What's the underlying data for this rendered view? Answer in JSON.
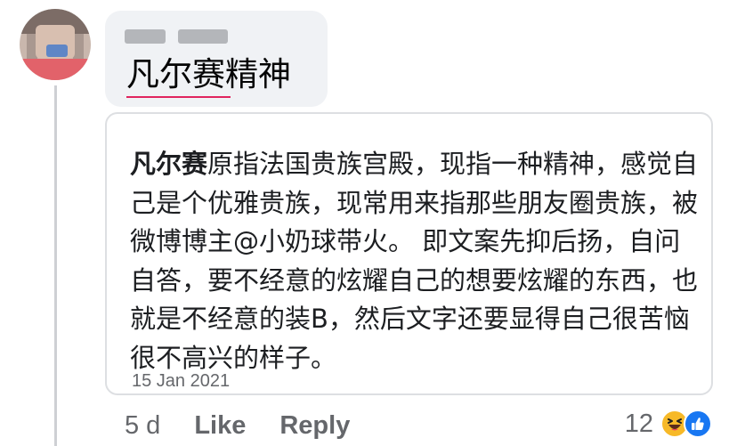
{
  "comment": {
    "author_name": "",
    "text": "凡尔赛精神",
    "underlined_text": "凡尔赛"
  },
  "quote": {
    "lead": "凡尔赛",
    "body": "原指法国贵族宫殿，现指一种精神，感觉自己是个优雅贵族，现常用来指那些朋友圈贵族，被微博博主@小奶球带火。 即文案先抑后扬，自问自答，要不经意的炫耀自己的想要炫耀的东西，也就是不经意的装B，然后文字还要显得自己很苦恼很不高兴的样子。",
    "date": "15 Jan 2021"
  },
  "actions": {
    "age": "5 d",
    "like_label": "Like",
    "reply_label": "Reply"
  },
  "reactions": {
    "count": "12",
    "icons": [
      "haha-reaction-icon",
      "like-reaction-icon"
    ]
  },
  "colors": {
    "bubble_bg": "#f0f2f5",
    "underline": "#e0245e",
    "meta_text": "#65676b",
    "like_blue": "#1877f2",
    "haha_yellow": "#f7b928"
  }
}
